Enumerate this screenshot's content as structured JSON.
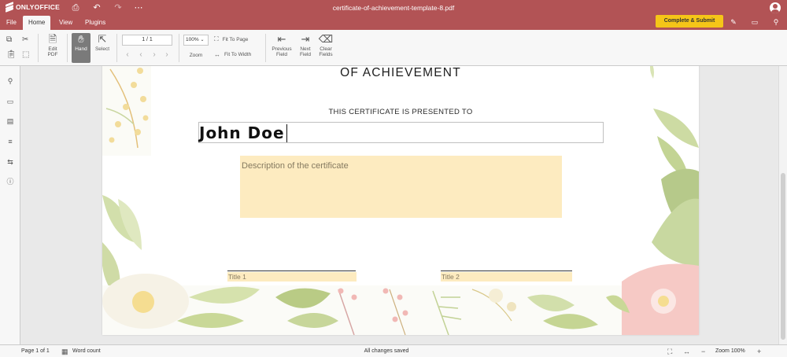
{
  "app": {
    "brand": "ONLYOFFICE",
    "document_title": "certificate-of-achievement-template-8.pdf"
  },
  "menu": {
    "tabs": [
      "File",
      "Home",
      "View",
      "Plugins"
    ],
    "active_tab": "Home",
    "complete_submit_label": "Complete & Submit"
  },
  "toolbar": {
    "edit_pdf_label": "Edit PDF",
    "hand_label": "Hand",
    "select_label": "Select",
    "page_indicator": "1 / 1",
    "zoom_value": "100%",
    "zoom_label": "Zoom",
    "fit_to_page_label": "Fit To Page",
    "fit_to_width_label": "Fit To Width",
    "previous_field_label": "Previous Field",
    "next_field_label": "Next Field",
    "clear_fields_label": "Clear Fields"
  },
  "document": {
    "heading": "OF ACHIEVEMENT",
    "presented_to": "THIS CERTIFICATE IS PRESENTED TO",
    "recipient_name": "John Doe",
    "description_placeholder": "Description of the certificate",
    "title1_placeholder": "Title 1",
    "title2_placeholder": "Title 2"
  },
  "statusbar": {
    "page_info": "Page 1 of 1",
    "word_count_label": "Word count",
    "save_status": "All changes saved",
    "zoom_label": "Zoom 100%"
  },
  "colors": {
    "header": "#b25355",
    "accent_button": "#f5c518",
    "form_field_fill": "#fdebc0"
  }
}
